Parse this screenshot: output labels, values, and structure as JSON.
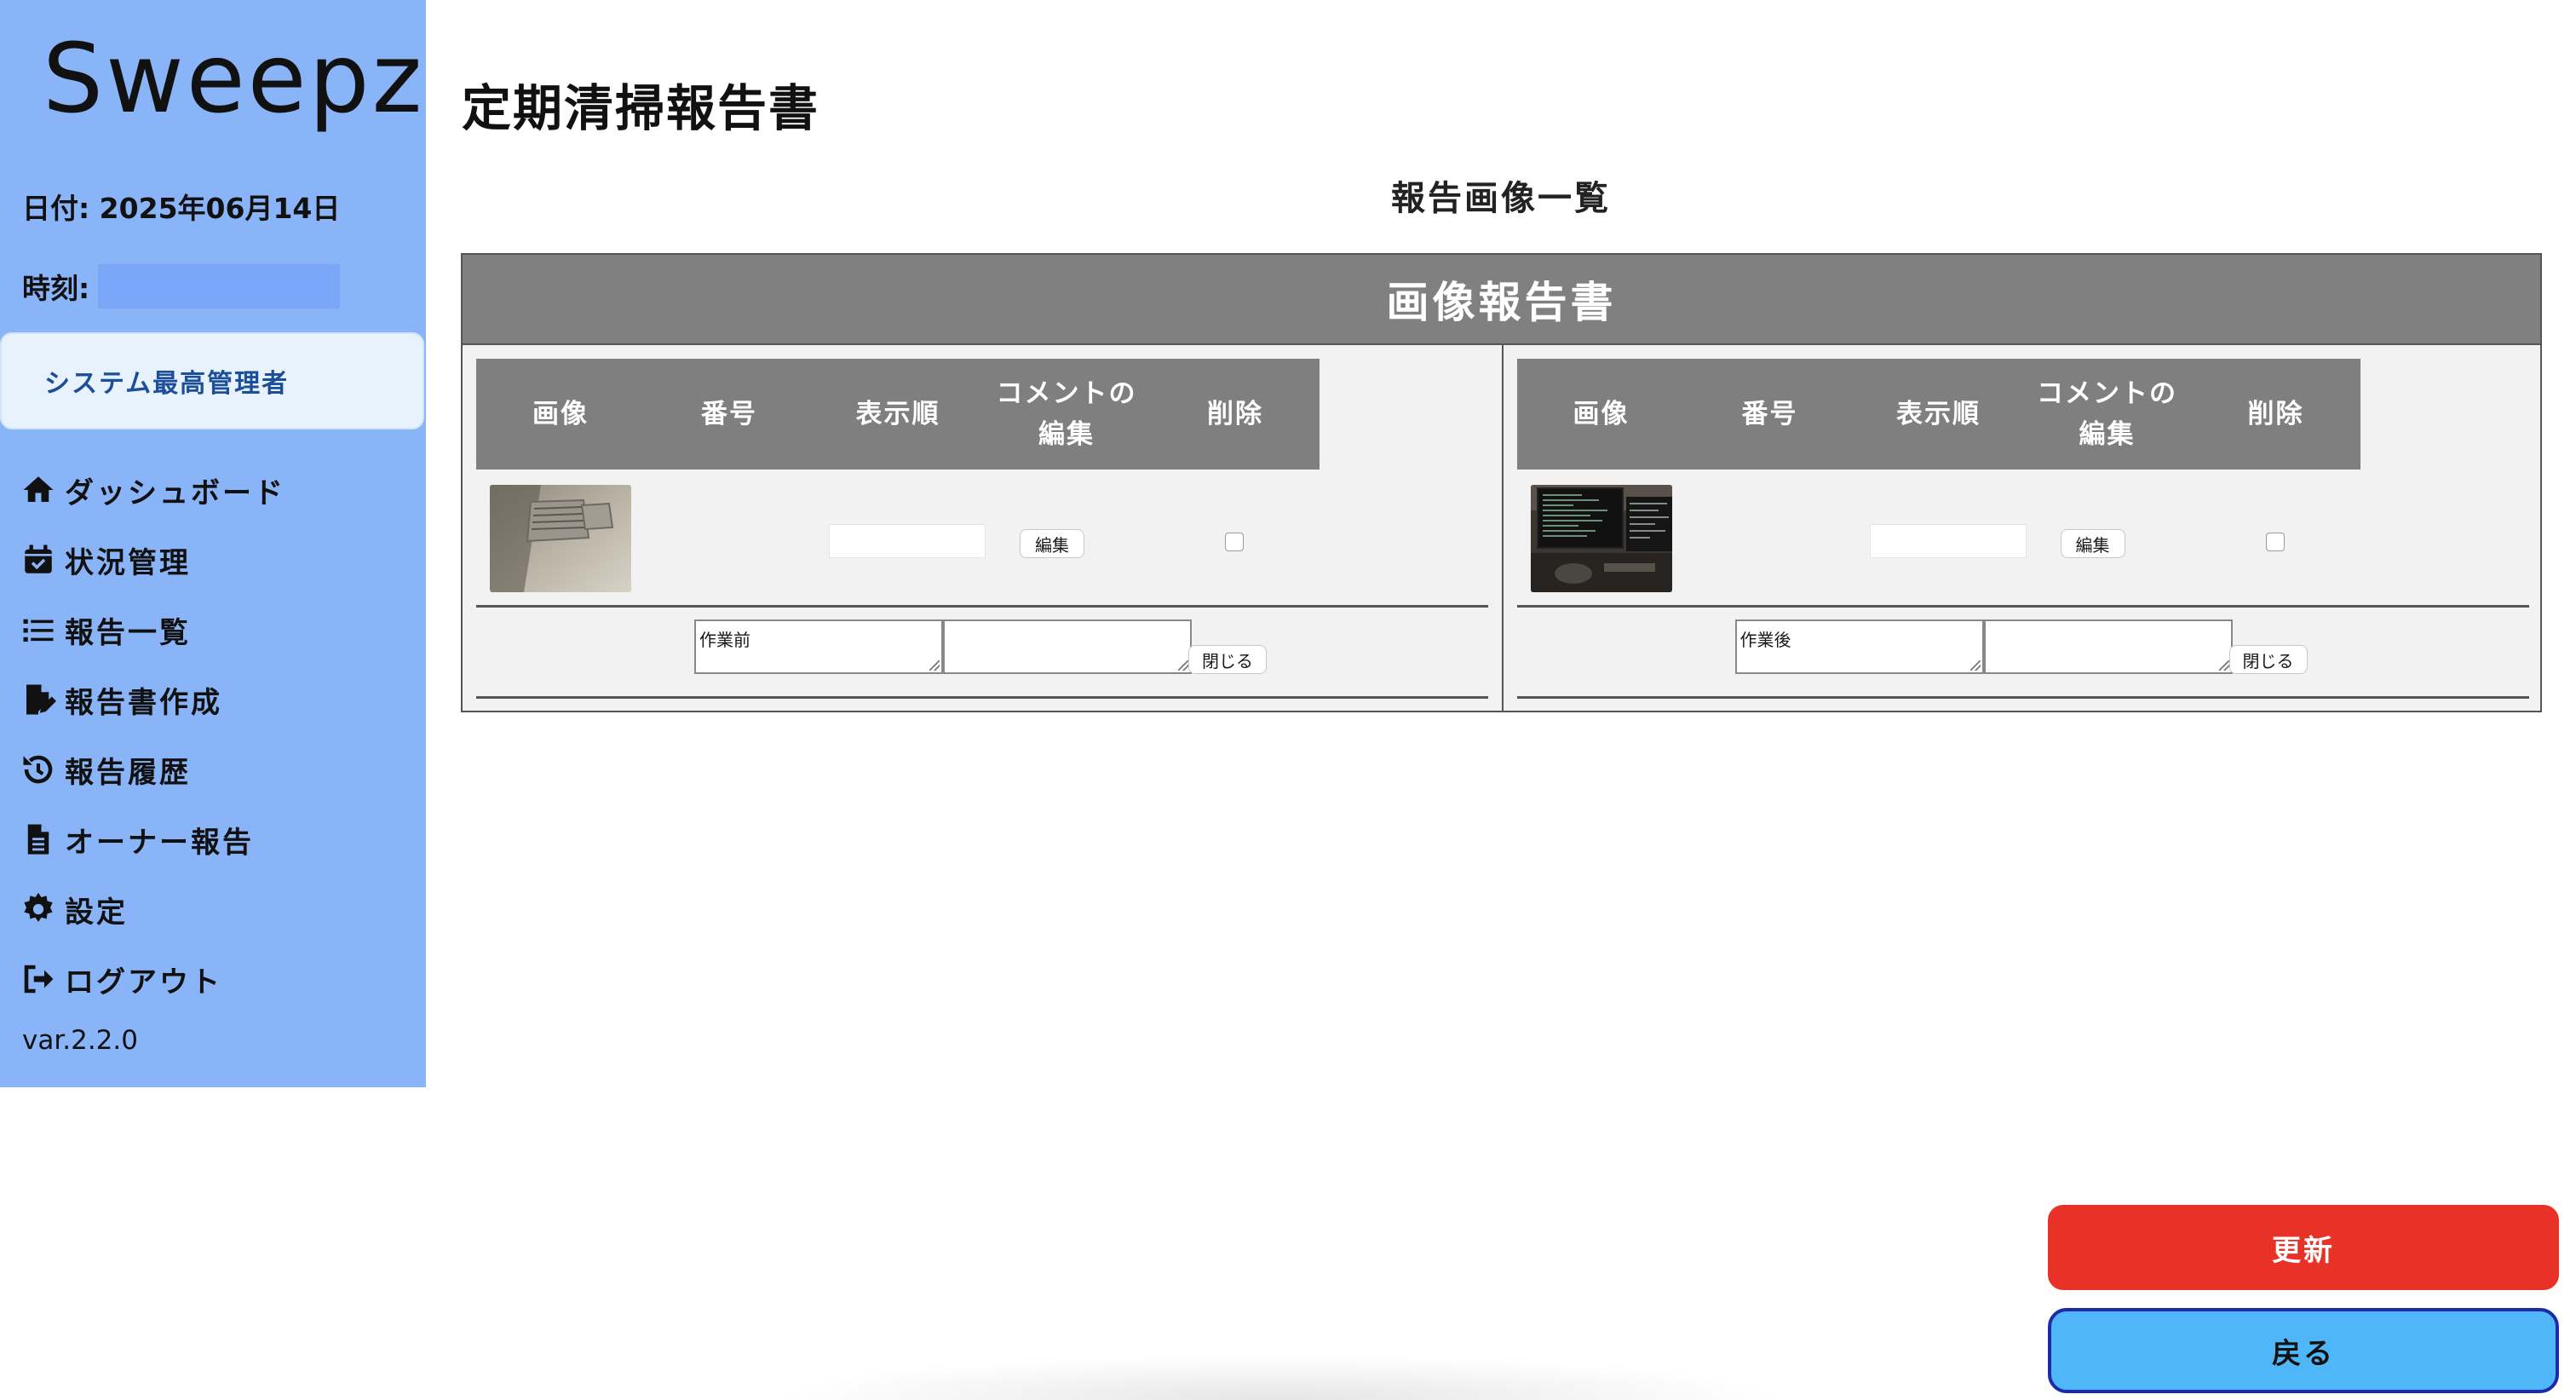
{
  "sidebar": {
    "logo": "Sweepz",
    "date": "日付: 2025年06月14日",
    "time_label": "時刻:",
    "role": "システム最高管理者",
    "items": [
      {
        "label": "ダッシュボード",
        "icon": "home-icon"
      },
      {
        "label": "状況管理",
        "icon": "calendar-check-icon"
      },
      {
        "label": "報告一覧",
        "icon": "list-icon"
      },
      {
        "label": "報告書作成",
        "icon": "file-edit-icon"
      },
      {
        "label": "報告履歴",
        "icon": "history-icon"
      },
      {
        "label": "オーナー報告",
        "icon": "file-text-icon"
      },
      {
        "label": "設定",
        "icon": "gear-icon"
      },
      {
        "label": "ログアウト",
        "icon": "logout-icon"
      }
    ],
    "version": "var.2.2.0"
  },
  "main": {
    "title": "定期清掃報告書",
    "section_title": "報告画像一覧",
    "report_header": "画像報告書",
    "columns": [
      "画像",
      "番号",
      "表示順",
      "コメントの\n編集",
      "削除"
    ],
    "panels": [
      {
        "edit_label": "編集",
        "comment": "作業前",
        "comment2": "",
        "close_label": "閉じる",
        "thumb": "ceiling-vent-photo"
      },
      {
        "edit_label": "編集",
        "comment": "作業後",
        "comment2": "",
        "close_label": "閉じる",
        "thumb": "monitor-desk-photo"
      }
    ]
  },
  "buttons": {
    "update": "更新",
    "back": "戻る"
  },
  "colors": {
    "sidebar_bg": "#8ab4f8",
    "role_card_bg": "#e8f2fd",
    "table_header_bg": "#808080",
    "update_button": "#e83227",
    "back_button": "#4fb6f7",
    "back_button_border": "#1f2aa8"
  }
}
